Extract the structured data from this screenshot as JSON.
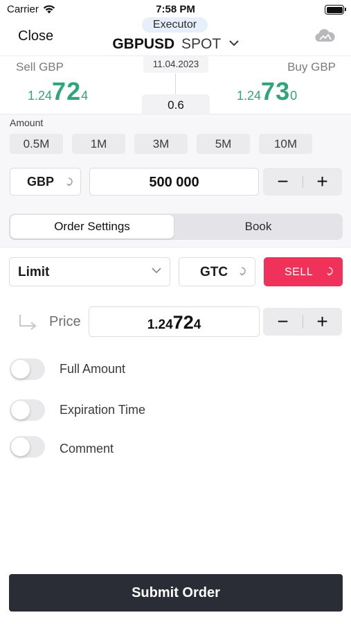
{
  "status_bar": {
    "carrier": "Carrier",
    "time": "7:58 PM"
  },
  "header": {
    "close_label": "Close",
    "executor_badge": "Executor",
    "pair": "GBPUSD",
    "market": "SPOT"
  },
  "quote": {
    "sell_label": "Sell GBP",
    "buy_label": "Buy GBP",
    "sell_price": {
      "prefix": "1.24",
      "big": "72",
      "pip": "4"
    },
    "buy_price": {
      "prefix": "1.24",
      "big": "73",
      "pip": "0"
    },
    "value_date": "11.04.2023",
    "spread": "0.6"
  },
  "amount": {
    "title": "Amount",
    "presets": [
      "0.5M",
      "1M",
      "3M",
      "5M",
      "10M"
    ],
    "currency": "GBP",
    "value": "500 000"
  },
  "tabs": {
    "order_settings": "Order Settings",
    "book": "Book"
  },
  "order": {
    "type": "Limit",
    "time_in_force": "GTC",
    "side": "SELL",
    "price_label": "Price",
    "price": {
      "prefix": "1.24",
      "big": "72",
      "pip": "4"
    }
  },
  "options": [
    {
      "label": "Full Amount",
      "on": false
    },
    {
      "label": "Expiration Time",
      "on": false
    },
    {
      "label": "Comment",
      "on": false
    }
  ],
  "submit_label": "Submit Order",
  "colors": {
    "price_green": "#2fa67a",
    "sell_red": "#f0325a",
    "submit_dark": "#2a2d36",
    "badge_blue": "#e6effa"
  }
}
